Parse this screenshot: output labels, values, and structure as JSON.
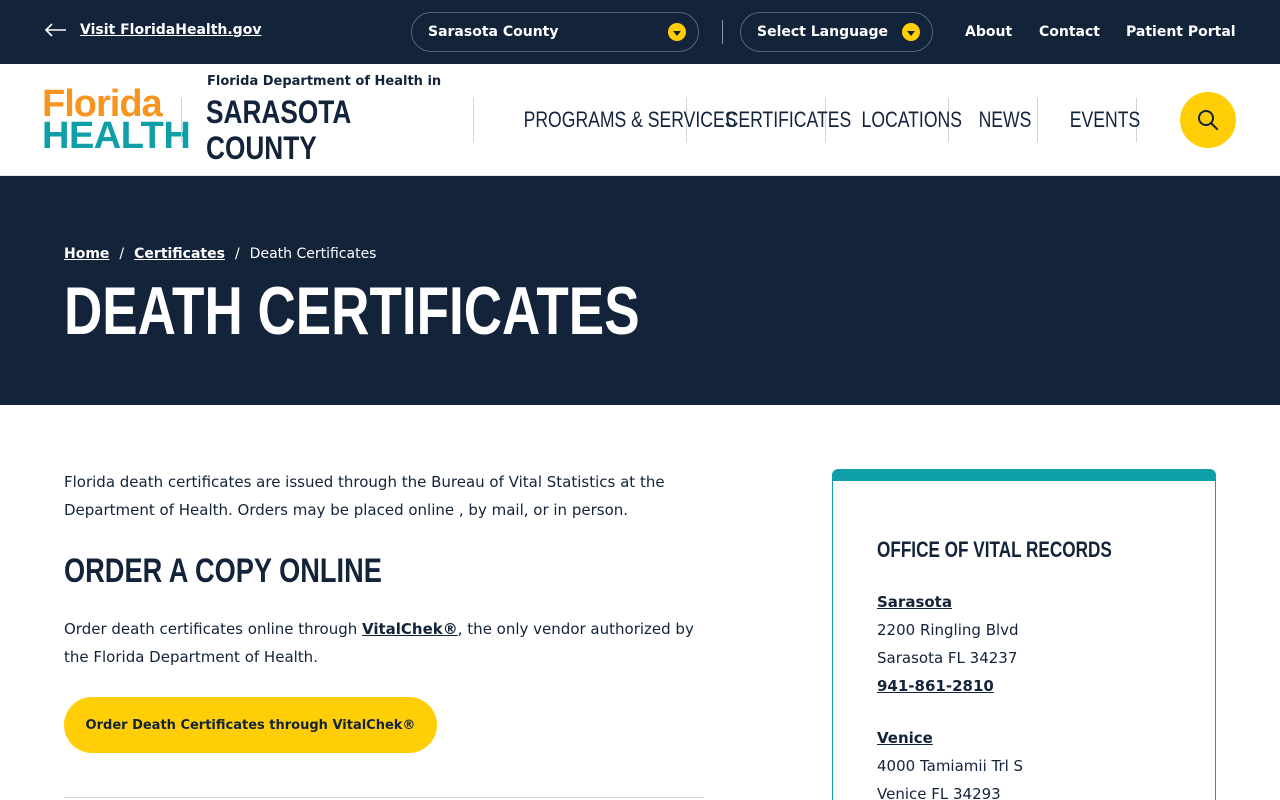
{
  "topbar": {
    "visit_label": "Visit FloridaHealth.gov",
    "county_select": "Sarasota County",
    "language_select": "Select Language",
    "links": [
      "About",
      "Contact",
      "Patient Portal"
    ]
  },
  "header": {
    "logo_line1": "Florida",
    "logo_line2": "HEALTH",
    "department": "Florida Department of Health in",
    "county_line1": "SARASOTA",
    "county_line2": "COUNTY",
    "nav": [
      "PROGRAMS & SERVICES",
      "CERTIFICATES",
      "LOCATIONS",
      "NEWS",
      "EVENTS"
    ]
  },
  "breadcrumb": {
    "home": "Home",
    "certificates": "Certificates",
    "current": "Death Certificates",
    "separator": "/"
  },
  "page_title": "DEATH CERTIFICATES",
  "content": {
    "intro": "Florida death certificates are issued through the Bureau of Vital Statistics at the Department of Health. Orders may be placed online , by mail, or in person.",
    "section_title": "ORDER A COPY ONLINE",
    "online_text_before": "Order death certificates online through ",
    "online_link": "VitalChek®",
    "online_text_after": ", the only vendor authorized by the Florida Department of Health.",
    "cta_label": "Order Death Certificates through VitalChek®"
  },
  "sidebar": {
    "title": "OFFICE OF VITAL RECORDS",
    "offices": [
      {
        "name": "Sarasota",
        "address": "2200 Ringling Blvd",
        "city": "Sarasota FL 34237",
        "phone": "941-861-2810"
      },
      {
        "name": "Venice",
        "address": "4000 Tamiamii Trl S",
        "city": "Venice FL 34293"
      }
    ]
  },
  "colors": {
    "navy": "#13233a",
    "yellow": "#ffce07",
    "teal": "#0f9fa6",
    "orange": "#f7941d"
  }
}
